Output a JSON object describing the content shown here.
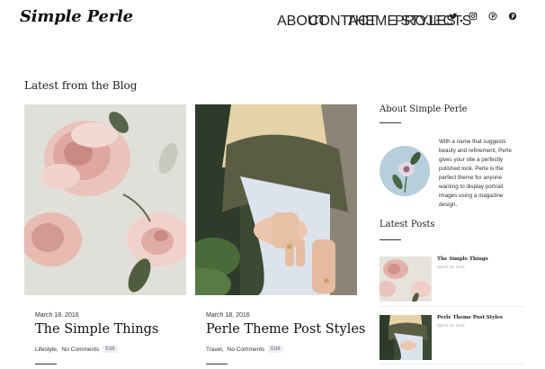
{
  "site": {
    "logo": "Simple Perle"
  },
  "nav": {
    "items": [
      {
        "label": "ABOUT"
      },
      {
        "label": "CONTACT"
      },
      {
        "label": "THEME STYLES"
      },
      {
        "label": "PROJECTS"
      }
    ],
    "social": [
      "twitter-icon",
      "instagram-icon",
      "pinterest-icon",
      "pinterest-icon"
    ]
  },
  "blog": {
    "heading": "Latest from the Blog",
    "posts": [
      {
        "date": "March 18, 2016",
        "title": "The Simple Things",
        "category": "Lifestyle,",
        "comments": "No Comments",
        "edit": "Edit"
      },
      {
        "date": "March 18, 2016",
        "title": "Perle Theme Post Styles",
        "category": "Travel,",
        "comments": "No Comments",
        "edit": "Edit"
      }
    ]
  },
  "sidebar": {
    "about": {
      "title": "About Simple Perle",
      "text": "With a name that suggests beauty and refinement, Perle gives your site a perfectly polished look. Perle is the perfect theme for anyone wanting to display portrait images using a magazine design."
    },
    "latest": {
      "title": "Latest Posts",
      "items": [
        {
          "title": "The Simple Things",
          "date": "March 18, 2016"
        },
        {
          "title": "Perle Theme Post Styles",
          "date": "March 18, 2016"
        }
      ]
    }
  }
}
